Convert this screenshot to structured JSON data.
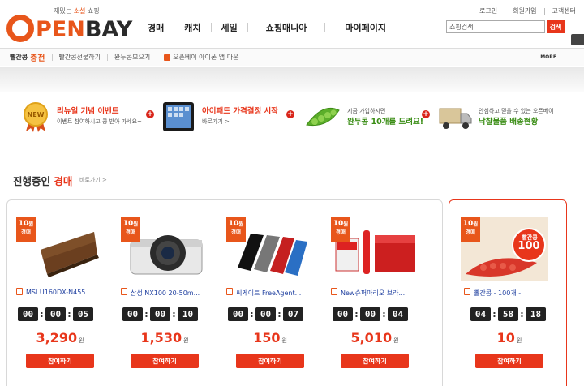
{
  "logo": {
    "tagline_pre": "재밌는 ",
    "tagline_hl": "소셜",
    "tagline_post": " 쇼핑",
    "text_a": "PEN",
    "text_b": "BAY"
  },
  "gnb": [
    "경매",
    "캐치",
    "세일",
    "쇼핑매니아",
    "마이페이지"
  ],
  "util": [
    "로그인",
    "회원가입",
    "고객센터"
  ],
  "search": {
    "value": "쇼핑검색",
    "button": "검색"
  },
  "subnav": {
    "brand": "빨간콩",
    "brand_accent": "충전",
    "items": [
      "빨간콩선물하기",
      "완두콩모으기"
    ],
    "notice": "오픈베이 아이폰 앱 다운",
    "more": "MORE"
  },
  "promo": [
    {
      "title": "리뉴얼 기념 이벤트",
      "sub": "이벤트 참여하시고 콩 받아 가세요~",
      "style": "red"
    },
    {
      "title": "아이패드 가격결정 시작",
      "sub": "바로가기 >",
      "style": "red"
    },
    {
      "title": "완두콩 10개를 드려요!",
      "pre": "지금 가입하시면",
      "style": "green"
    },
    {
      "title": "낙찰물품 배송현황",
      "pre": "안심하고 믿을 수 있는 오픈베이",
      "style": "green"
    }
  ],
  "section": {
    "title_pre": "진행중인 ",
    "title_hl": "경매",
    "more": "바로가기 >"
  },
  "badge": {
    "num": "10",
    "unit": "원",
    "label": "경매"
  },
  "cards": [
    {
      "name": "MSI U160DX-N455 ...",
      "h": "00",
      "m": "00",
      "s": "05",
      "price": "3,290",
      "unit": "원",
      "bid": "참여하기"
    },
    {
      "name": "삼성 NX100 20-50m...",
      "h": "00",
      "m": "00",
      "s": "10",
      "price": "1,530",
      "unit": "원",
      "bid": "참여하기"
    },
    {
      "name": "씨게이트 FreeAgent...",
      "h": "00",
      "m": "00",
      "s": "07",
      "price": "150",
      "unit": "원",
      "bid": "참여하기"
    },
    {
      "name": "New슈퍼마리오 브라...",
      "h": "00",
      "m": "00",
      "s": "04",
      "price": "5,010",
      "unit": "원",
      "bid": "참여하기"
    },
    {
      "name": "빨간콩 - 100개 -",
      "h": "04",
      "m": "58",
      "s": "18",
      "price": "10",
      "unit": "원",
      "bid": "참여하기",
      "bean_label": "빨간콩",
      "bean_count": "100"
    }
  ]
}
